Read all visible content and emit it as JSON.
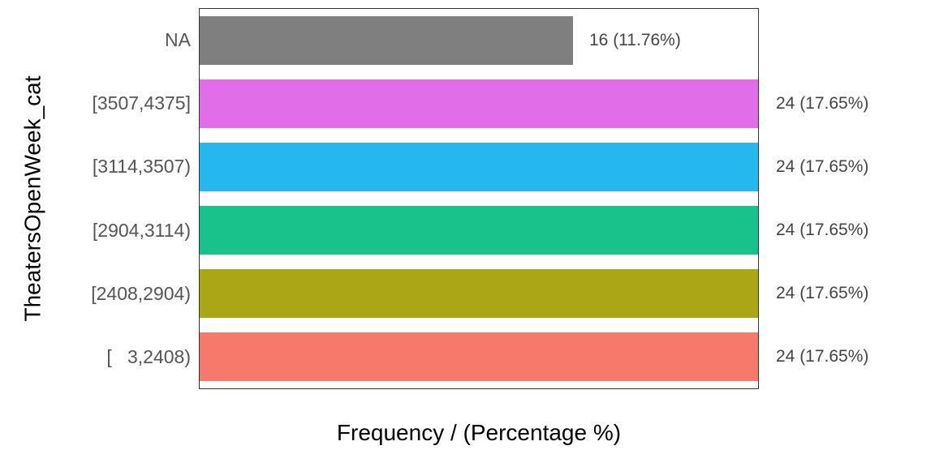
{
  "chart_data": {
    "type": "bar",
    "orientation": "horizontal",
    "ylabel": "TheatersOpenWeek_cat",
    "xlabel": "Frequency / (Percentage %)",
    "x_max": 24,
    "categories": [
      {
        "label": "NA",
        "value": 16,
        "pct": "11.76%",
        "text": "16 (11.76%)",
        "color": "#7f7f7f"
      },
      {
        "label": "[3507,4375]",
        "value": 24,
        "pct": "17.65%",
        "text": "24 (17.65%)",
        "color": "#e16ee8"
      },
      {
        "label": "[3114,3507)",
        "value": 24,
        "pct": "17.65%",
        "text": "24 (17.65%)",
        "color": "#24b8ee"
      },
      {
        "label": "[2904,3114)",
        "value": 24,
        "pct": "17.65%",
        "text": "24 (17.65%)",
        "color": "#19c28b"
      },
      {
        "label": "[2408,2904)",
        "value": 24,
        "pct": "17.65%",
        "text": "24 (17.65%)",
        "color": "#a9a715"
      },
      {
        "label": "[   3,2408)",
        "value": 24,
        "pct": "17.65%",
        "text": "24 (17.65%)",
        "color": "#f7796c"
      }
    ]
  }
}
